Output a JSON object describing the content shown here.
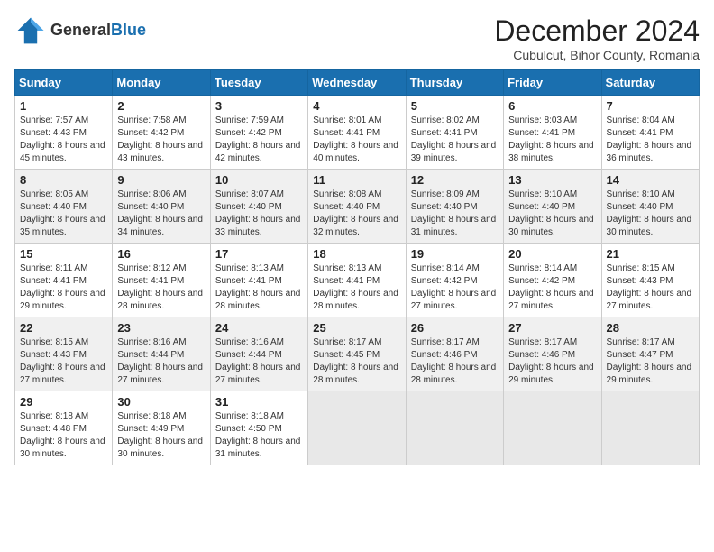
{
  "header": {
    "logo_general": "General",
    "logo_blue": "Blue",
    "month_year": "December 2024",
    "location": "Cubulcut, Bihor County, Romania"
  },
  "weekdays": [
    "Sunday",
    "Monday",
    "Tuesday",
    "Wednesday",
    "Thursday",
    "Friday",
    "Saturday"
  ],
  "weeks": [
    [
      {
        "day": "1",
        "sunrise": "7:57 AM",
        "sunset": "4:43 PM",
        "daylight": "8 hours and 45 minutes."
      },
      {
        "day": "2",
        "sunrise": "7:58 AM",
        "sunset": "4:42 PM",
        "daylight": "8 hours and 43 minutes."
      },
      {
        "day": "3",
        "sunrise": "7:59 AM",
        "sunset": "4:42 PM",
        "daylight": "8 hours and 42 minutes."
      },
      {
        "day": "4",
        "sunrise": "8:01 AM",
        "sunset": "4:41 PM",
        "daylight": "8 hours and 40 minutes."
      },
      {
        "day": "5",
        "sunrise": "8:02 AM",
        "sunset": "4:41 PM",
        "daylight": "8 hours and 39 minutes."
      },
      {
        "day": "6",
        "sunrise": "8:03 AM",
        "sunset": "4:41 PM",
        "daylight": "8 hours and 38 minutes."
      },
      {
        "day": "7",
        "sunrise": "8:04 AM",
        "sunset": "4:41 PM",
        "daylight": "8 hours and 36 minutes."
      }
    ],
    [
      {
        "day": "8",
        "sunrise": "8:05 AM",
        "sunset": "4:40 PM",
        "daylight": "8 hours and 35 minutes."
      },
      {
        "day": "9",
        "sunrise": "8:06 AM",
        "sunset": "4:40 PM",
        "daylight": "8 hours and 34 minutes."
      },
      {
        "day": "10",
        "sunrise": "8:07 AM",
        "sunset": "4:40 PM",
        "daylight": "8 hours and 33 minutes."
      },
      {
        "day": "11",
        "sunrise": "8:08 AM",
        "sunset": "4:40 PM",
        "daylight": "8 hours and 32 minutes."
      },
      {
        "day": "12",
        "sunrise": "8:09 AM",
        "sunset": "4:40 PM",
        "daylight": "8 hours and 31 minutes."
      },
      {
        "day": "13",
        "sunrise": "8:10 AM",
        "sunset": "4:40 PM",
        "daylight": "8 hours and 30 minutes."
      },
      {
        "day": "14",
        "sunrise": "8:10 AM",
        "sunset": "4:40 PM",
        "daylight": "8 hours and 30 minutes."
      }
    ],
    [
      {
        "day": "15",
        "sunrise": "8:11 AM",
        "sunset": "4:41 PM",
        "daylight": "8 hours and 29 minutes."
      },
      {
        "day": "16",
        "sunrise": "8:12 AM",
        "sunset": "4:41 PM",
        "daylight": "8 hours and 28 minutes."
      },
      {
        "day": "17",
        "sunrise": "8:13 AM",
        "sunset": "4:41 PM",
        "daylight": "8 hours and 28 minutes."
      },
      {
        "day": "18",
        "sunrise": "8:13 AM",
        "sunset": "4:41 PM",
        "daylight": "8 hours and 28 minutes."
      },
      {
        "day": "19",
        "sunrise": "8:14 AM",
        "sunset": "4:42 PM",
        "daylight": "8 hours and 27 minutes."
      },
      {
        "day": "20",
        "sunrise": "8:14 AM",
        "sunset": "4:42 PM",
        "daylight": "8 hours and 27 minutes."
      },
      {
        "day": "21",
        "sunrise": "8:15 AM",
        "sunset": "4:43 PM",
        "daylight": "8 hours and 27 minutes."
      }
    ],
    [
      {
        "day": "22",
        "sunrise": "8:15 AM",
        "sunset": "4:43 PM",
        "daylight": "8 hours and 27 minutes."
      },
      {
        "day": "23",
        "sunrise": "8:16 AM",
        "sunset": "4:44 PM",
        "daylight": "8 hours and 27 minutes."
      },
      {
        "day": "24",
        "sunrise": "8:16 AM",
        "sunset": "4:44 PM",
        "daylight": "8 hours and 27 minutes."
      },
      {
        "day": "25",
        "sunrise": "8:17 AM",
        "sunset": "4:45 PM",
        "daylight": "8 hours and 28 minutes."
      },
      {
        "day": "26",
        "sunrise": "8:17 AM",
        "sunset": "4:46 PM",
        "daylight": "8 hours and 28 minutes."
      },
      {
        "day": "27",
        "sunrise": "8:17 AM",
        "sunset": "4:46 PM",
        "daylight": "8 hours and 29 minutes."
      },
      {
        "day": "28",
        "sunrise": "8:17 AM",
        "sunset": "4:47 PM",
        "daylight": "8 hours and 29 minutes."
      }
    ],
    [
      {
        "day": "29",
        "sunrise": "8:18 AM",
        "sunset": "4:48 PM",
        "daylight": "8 hours and 30 minutes."
      },
      {
        "day": "30",
        "sunrise": "8:18 AM",
        "sunset": "4:49 PM",
        "daylight": "8 hours and 30 minutes."
      },
      {
        "day": "31",
        "sunrise": "8:18 AM",
        "sunset": "4:50 PM",
        "daylight": "8 hours and 31 minutes."
      },
      null,
      null,
      null,
      null
    ]
  ],
  "labels": {
    "sunrise": "Sunrise:",
    "sunset": "Sunset:",
    "daylight": "Daylight:"
  }
}
